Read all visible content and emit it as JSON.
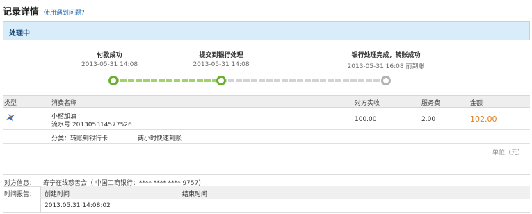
{
  "header": {
    "title": "记录详情",
    "help_link": "使用遇到问题?"
  },
  "status": {
    "text": "处理中"
  },
  "progress": {
    "steps": [
      {
        "label": "付款成功",
        "time": "2013-05-31 14:08",
        "state": "done"
      },
      {
        "label": "提交到银行处理",
        "time": "2013-05-31 14:08",
        "state": "done"
      },
      {
        "label": "银行处理完成，转账成功",
        "time": "2013-05-31 16:08 前到账",
        "state": "pending"
      }
    ]
  },
  "table": {
    "columns": [
      "类型",
      "消费名称",
      "对方实收",
      "服务费",
      "金额"
    ],
    "row": {
      "type_icon": "transfer-bird-icon",
      "name": "小楷加油",
      "serial": "流水号 201305314577526",
      "received": "100.00",
      "fee": "2.00",
      "amount": "102.00",
      "category": "分类：转账到银行卡",
      "speed": "两小时快速到账"
    },
    "unit": "单位（元）"
  },
  "counterparty": {
    "label": "对方信息：",
    "value": "寿宁在线慈善会（ 中国工商银行：**** **** **** 9757）"
  },
  "time_report": {
    "label": "时间报告：",
    "created_label": "创建时间",
    "ended_label": "结束时间",
    "created_value": "2013.05.31 14:08:02",
    "ended_value": ""
  },
  "colors": {
    "accent": "#6bb12e",
    "amount": "#e27d1b",
    "status_bg": "#d9ecf9",
    "link": "#2a6db8"
  }
}
